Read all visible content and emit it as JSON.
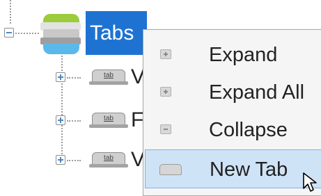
{
  "tree": {
    "root": {
      "label": "Tabs",
      "expanded": true,
      "icon": "tabs-stack-icon"
    },
    "children": [
      {
        "tab_text": "tab",
        "label_fragment": "V",
        "icon": "tab-icon"
      },
      {
        "tab_text": "tab",
        "label_fragment": "F",
        "icon": "tab-icon"
      },
      {
        "tab_text": "tab",
        "label_fragment": "V",
        "icon": "tab-icon"
      }
    ]
  },
  "context_menu": {
    "items": [
      {
        "label": "Expand",
        "icon": "expand-icon"
      },
      {
        "label": "Expand All",
        "icon": "expand-all-icon"
      },
      {
        "label": "Collapse",
        "icon": "collapse-icon"
      },
      {
        "label": "New Tab",
        "icon": "new-tab-icon",
        "selected": true
      }
    ]
  },
  "colors": {
    "selection": "#1e73d2",
    "menu_highlight": "#cfe3f7",
    "stack_green": "#9ccb3c",
    "stack_gray": "#c8c8c8",
    "stack_blue": "#5bb8ea"
  }
}
